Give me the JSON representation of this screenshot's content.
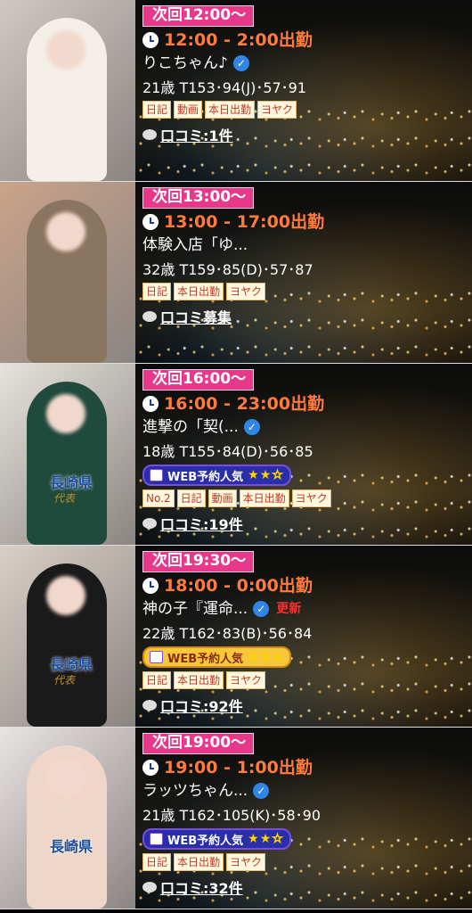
{
  "cards": [
    {
      "next": "次回12:00〜",
      "time": "12:00 - 2:00出勤",
      "name": "りこちゃん♪",
      "verified": true,
      "update": "",
      "stats": "21歳 T153･94(J)･57･91",
      "web": null,
      "tags": [
        "日記",
        "動画",
        "本日出勤",
        "ヨヤク"
      ],
      "review": "口コミ:1件",
      "photo_colors": {
        "bg": "#cfc8c4",
        "person": "#f4efe8"
      },
      "badge": {
        "text": "",
        "sub": ""
      }
    },
    {
      "next": "次回13:00〜",
      "time": "13:00 - 17:00出勤",
      "name": "体験入店「ゆ...",
      "verified": false,
      "update": "",
      "stats": "32歳 T159･85(D)･57･87",
      "web": null,
      "tags": [
        "日記",
        "本日出勤",
        "ヨヤク"
      ],
      "review": "口コミ募集",
      "photo_colors": {
        "bg": "#caa38a",
        "person": "#8a7560"
      },
      "badge": {
        "text": "",
        "sub": ""
      }
    },
    {
      "next": "次回16:00〜",
      "time": "16:00 - 23:00出勤",
      "name": "進撃の「契(...",
      "verified": true,
      "update": "",
      "stats": "18歳 T155･84(D)･56･85",
      "web": {
        "label": "WEB予約人気",
        "style": "blue",
        "stars": 2
      },
      "tags": [
        "No.2",
        "日記",
        "動画",
        "本日出勤",
        "ヨヤク"
      ],
      "review": "口コミ:19件",
      "photo_colors": {
        "bg": "#e6e2dc",
        "person": "#1f4a3c"
      },
      "badge": {
        "text": "長崎県",
        "sub": "代表"
      }
    },
    {
      "next": "次回19:30〜",
      "time": "18:00 - 0:00出勤",
      "name": "神の子『運命...",
      "verified": true,
      "update": "更新",
      "stats": "22歳 T162･83(B)･56･84",
      "web": {
        "label": "WEB予約人気",
        "style": "gold",
        "stars": 3
      },
      "tags": [
        "日記",
        "本日出勤",
        "ヨヤク"
      ],
      "review": "口コミ:92件",
      "photo_colors": {
        "bg": "#d9d0c6",
        "person": "#1a1a1a"
      },
      "badge": {
        "text": "長崎県",
        "sub": "代表"
      }
    },
    {
      "next": "次回19:00〜",
      "time": "19:00 - 1:00出勤",
      "name": "ラッツちゃん...",
      "verified": true,
      "update": "",
      "stats": "21歳 T162･105(K)･58･90",
      "web": {
        "label": "WEB予約人気",
        "style": "blue",
        "stars": 2
      },
      "tags": [
        "日記",
        "本日出勤",
        "ヨヤク"
      ],
      "review": "口コミ:32件",
      "photo_colors": {
        "bg": "#e9e4e4",
        "person": "#f0d6c8"
      },
      "badge": {
        "text": "長崎県",
        "sub": ""
      }
    }
  ]
}
